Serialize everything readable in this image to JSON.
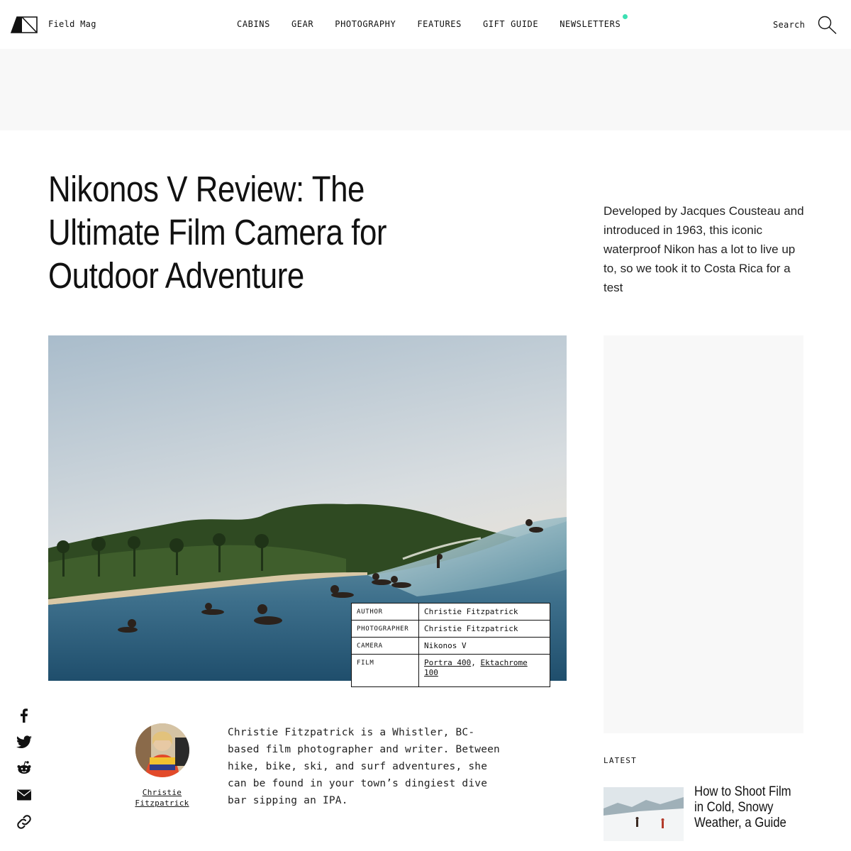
{
  "header": {
    "brand": "Field Mag",
    "nav": [
      {
        "label": "CABINS"
      },
      {
        "label": "GEAR"
      },
      {
        "label": "PHOTOGRAPHY"
      },
      {
        "label": "FEATURES"
      },
      {
        "label": "GIFT GUIDE"
      },
      {
        "label": "NEWSLETTERS"
      }
    ],
    "search_label": "Search",
    "accent_color": "#3de0b3"
  },
  "article": {
    "title": "Nikonos V Review: The Ultimate Film Camera for Outdoor Adventure",
    "dek": "Developed by Jacques Cousteau and introduced in 1963, this iconic waterproof Nikon has a lot to live up to, so we took it to Costa Rica for a test",
    "credits": {
      "author_key": "AUTHOR",
      "author_value": "Christie Fitzpatrick",
      "photographer_key": "PHOTOGRAPHER",
      "photographer_value": "Christie Fitzpatrick",
      "camera_key": "CAMERA",
      "camera_value": "Nikonos V",
      "film_key": "FILM",
      "film_values": [
        "Portra 400",
        "Ektachrome 100"
      ],
      "film_separator": ", "
    }
  },
  "share": {
    "icons": [
      "facebook-icon",
      "twitter-icon",
      "reddit-icon",
      "email-icon",
      "link-icon"
    ]
  },
  "author": {
    "name": "Christie Fitzpatrick",
    "bio": "Christie Fitzpatrick is a Whistler, BC-based film photographer and writer. Between hike, bike, ski, and surf adventures, she can be found in your town’s dingiest dive bar sipping an IPA."
  },
  "latest": {
    "label": "LATEST",
    "items": [
      {
        "title": "How to Shoot Film in Cold, Snowy Weather, a Guide"
      }
    ]
  }
}
